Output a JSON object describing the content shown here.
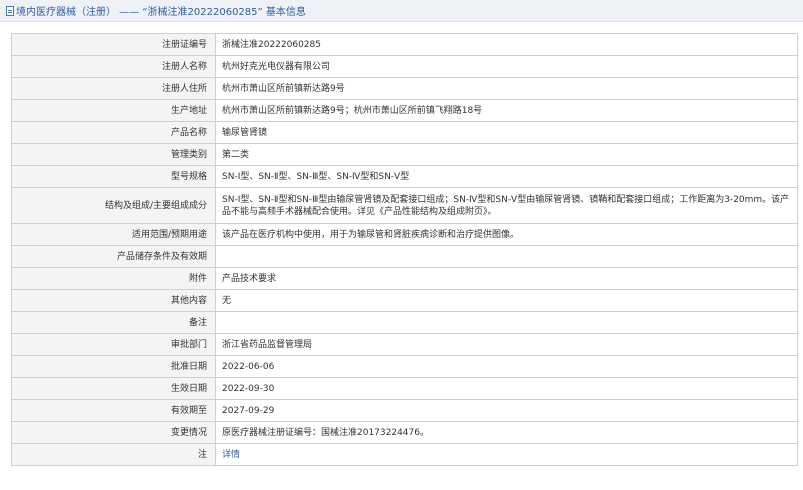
{
  "header": {
    "title": "境内医疗器械（注册） —— “浙械注准20222060285” 基本信息"
  },
  "rows": [
    {
      "label": "注册证编号",
      "value": "浙械注准20222060285"
    },
    {
      "label": "注册人名称",
      "value": "杭州好克光电仪器有限公司"
    },
    {
      "label": "注册人住所",
      "value": "杭州市萧山区所前镇新达路9号"
    },
    {
      "label": "生产地址",
      "value": "杭州市萧山区所前镇新达路9号；杭州市萧山区所前镇飞翔路18号"
    },
    {
      "label": "产品名称",
      "value": "输尿管肾镜"
    },
    {
      "label": "管理类别",
      "value": "第二类"
    },
    {
      "label": "型号规格",
      "value": "SN-Ⅰ型、SN-Ⅱ型、SN-Ⅲ型、SN-Ⅳ型和SN-Ⅴ型"
    },
    {
      "label": "结构及组成/主要组成成分",
      "value": "SN-Ⅰ型、SN-Ⅱ型和SN-Ⅲ型由输尿管肾镜及配套接口组成；SN-Ⅳ型和SN-Ⅴ型由输尿管肾镜、镜鞘和配套接口组成；工作距离为3-20mm。该产品不能与高频手术器械配合使用。详见《产品性能结构及组成附页》。"
    },
    {
      "label": "适用范围/预期用途",
      "value": "该产品在医疗机构中使用，用于为输尿管和肾脏疾病诊断和治疗提供图像。"
    },
    {
      "label": "产品储存条件及有效期",
      "value": ""
    },
    {
      "label": "附件",
      "value": "产品技术要求"
    },
    {
      "label": "其他内容",
      "value": "无"
    },
    {
      "label": "备注",
      "value": ""
    },
    {
      "label": "审批部门",
      "value": "浙江省药品监督管理局"
    },
    {
      "label": "批准日期",
      "value": "2022-06-06"
    },
    {
      "label": "生效日期",
      "value": "2022-09-30"
    },
    {
      "label": "有效期至",
      "value": "2027-09-29"
    },
    {
      "label": "变更情况",
      "value": "原医疗器械注册证编号：国械注准20173224476。"
    },
    {
      "label": "注",
      "value": "详情"
    }
  ]
}
